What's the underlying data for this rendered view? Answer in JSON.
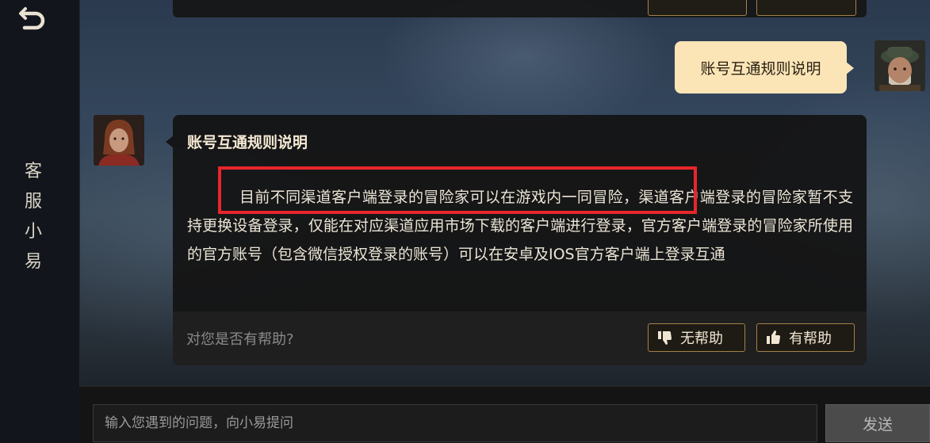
{
  "sidebar": {
    "title_chars": [
      "客",
      "服",
      "小",
      "易"
    ],
    "back_icon": "back-arrow-icon"
  },
  "user_message": {
    "text": "账号互通规则说明"
  },
  "answer": {
    "title": "账号互通规则说明",
    "body": "目前不同渠道客户端登录的冒险家可以在游戏内一同冒险，渠道客户端登录的冒险家暂不支持更换设备登录，仅能在对应渠道应用市场下载的客户端进行登录，官方客户端登录的冒险家所使用的官方账号（包含微信授权登录的账号）可以在安卓及IOS官方客户端上登录互通",
    "feedback_question": "对您是否有帮助?",
    "not_helpful_label": "无帮助",
    "helpful_label": "有帮助",
    "not_helpful_icon": "thumbs-down-icon",
    "helpful_icon": "thumbs-up-icon"
  },
  "input": {
    "placeholder": "输入您遇到的问题，向小易提问",
    "send_label": "发送"
  },
  "colors": {
    "accent_border": "#a3824a",
    "user_bubble": "#fbe5b6",
    "highlight": "#e8262b"
  }
}
